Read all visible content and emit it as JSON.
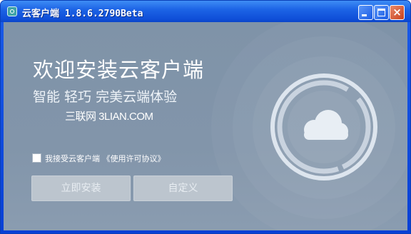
{
  "window": {
    "title": "云客户端 1.8.6.2790Beta",
    "controls": {
      "minimize": "minimize",
      "maximize": "maximize",
      "close": "×"
    }
  },
  "main": {
    "heading": "欢迎安装云客户端",
    "subheading": "智能 轻巧 完美云端体验",
    "watermark": "三联网 3LIAN.COM",
    "agreement": {
      "checked": false,
      "label": "我接受云客户端 《使用许可协议》"
    },
    "buttons": {
      "install": "立即安装",
      "custom": "自定义"
    }
  },
  "logo": {
    "icon": "cloud-icon"
  },
  "colors": {
    "titlebar": "#1d64e6",
    "background": "#8295aa",
    "button": "#bcc5ce"
  }
}
